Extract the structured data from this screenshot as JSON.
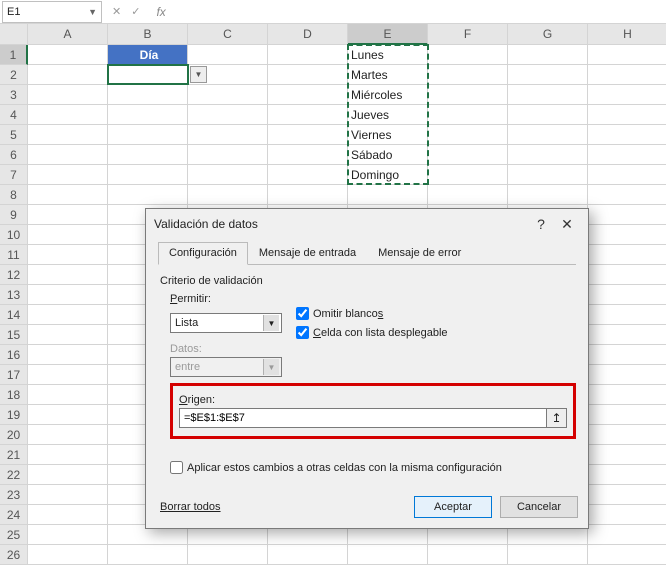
{
  "namebox": "E1",
  "fx": "fx",
  "columns": [
    "A",
    "B",
    "C",
    "D",
    "E",
    "F",
    "G",
    "H"
  ],
  "rows": [
    1,
    2,
    3,
    4,
    5,
    6,
    7,
    8,
    9,
    10,
    11,
    12,
    13,
    14,
    15,
    16,
    17,
    18,
    19,
    20,
    21,
    22,
    23,
    24,
    25,
    26
  ],
  "header_cell": "Día",
  "days": [
    "Lunes",
    "Martes",
    "Miércoles",
    "Jueves",
    "Viernes",
    "Sábado",
    "Domingo"
  ],
  "dialog": {
    "title": "Validación de datos",
    "help": "?",
    "close": "✕",
    "tabs": {
      "config": "Configuración",
      "input": "Mensaje de entrada",
      "error": "Mensaje de error"
    },
    "criteria": "Criterio de validación",
    "allow_label": "Permitir:",
    "allow_value": "Lista",
    "omit_blank": "Omitir blancos",
    "omit_blank_u": "s",
    "cell_dd": "elda con lista desplegable",
    "cell_dd_u": "C",
    "data_label": "Datos:",
    "data_value": "entre",
    "origin_label": "Origen:",
    "origin_value": "=$E$1:$E$7",
    "apply": "Aplicar estos cambios a otras celdas con la misma configuración",
    "clear": "Borrar todos",
    "clear_u": "B",
    "ok": "Aceptar",
    "cancel": "Cancelar"
  }
}
